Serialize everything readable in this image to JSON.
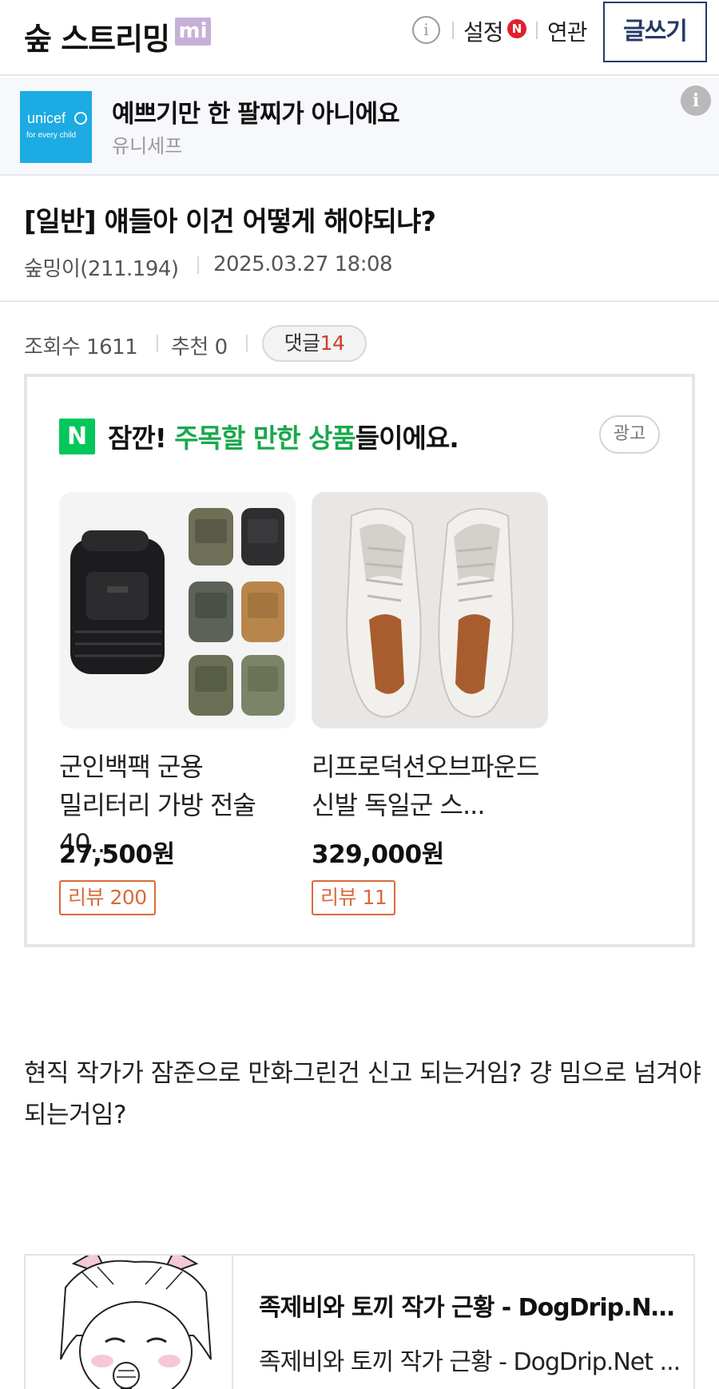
{
  "header": {
    "logo": "숲 스트리밍",
    "logo_badge": "mi",
    "info_icon": "info-icon",
    "settings_label": "설정",
    "new_badge": "N",
    "related_label": "연관",
    "write_button": "글쓰기"
  },
  "ad_banner": {
    "logo_text": "unicef",
    "logo_tagline": "for every child",
    "title": "예쁘기만 한 팔찌가 아니에요",
    "sponsor": "유니세프",
    "brand_color": "#1cabe2"
  },
  "post": {
    "title": "[일반] 얘들아 이건 어떻게 해야되냐?",
    "author": "숲밍이(211.194)",
    "date": "2025.03.27 18:08",
    "views_label": "조회수 1611",
    "recommend_label": "추천 0",
    "comments_label": "댓글",
    "comments_count": "14",
    "body": "현직 작가가 잠준으로 만화그린건 신고 되는거임? 걍 밈으로 넘겨야되는거임?"
  },
  "product_ad": {
    "logo": "N",
    "heading_prefix": "잠깐! ",
    "heading_highlight": "주목할 만한 상품",
    "heading_suffix": "들이에요.",
    "ad_label": "광고",
    "highlight_color": "#1aa84d",
    "products": [
      {
        "name": "군인백팩 군용 밀리터리 가방 전술 40...",
        "price": "27,500원",
        "review": "리뷰 200",
        "image": "backpack-image"
      },
      {
        "name": "리프로덕션오브파운드 신발 독일군 스...",
        "price": "329,000원",
        "review": "리뷰 11",
        "image": "sneakers-image"
      }
    ]
  },
  "link_card": {
    "title": "족제비와 토끼 작가 근황 - DogDrip.Net ...",
    "description": "족제비와 토끼 작가 근황 - DogDrip.Net ...",
    "thumbnail": "comic-thumbnail"
  }
}
